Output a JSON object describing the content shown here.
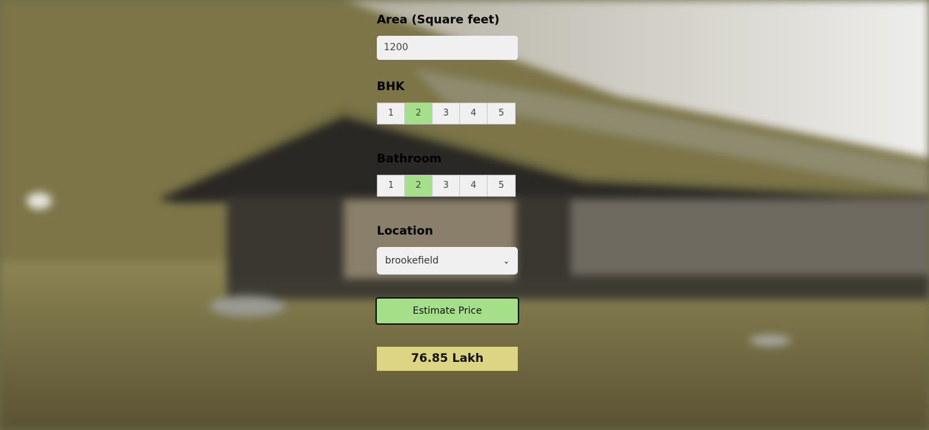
{
  "area": {
    "label": "Area (Square feet)",
    "value": "1200"
  },
  "bhk": {
    "label": "BHK",
    "options": [
      "1",
      "2",
      "3",
      "4",
      "5"
    ],
    "selected": "2"
  },
  "bathroom": {
    "label": "Bathroom",
    "options": [
      "1",
      "2",
      "3",
      "4",
      "5"
    ],
    "selected": "2"
  },
  "location": {
    "label": "Location",
    "selected": "brookefield"
  },
  "estimate_button": {
    "label": "Estimate Price"
  },
  "result": {
    "text": "76.85 Lakh"
  },
  "colors": {
    "selected_option": "#a4e08a",
    "button": "#a6df8a",
    "result_bg": "#ddd583"
  }
}
